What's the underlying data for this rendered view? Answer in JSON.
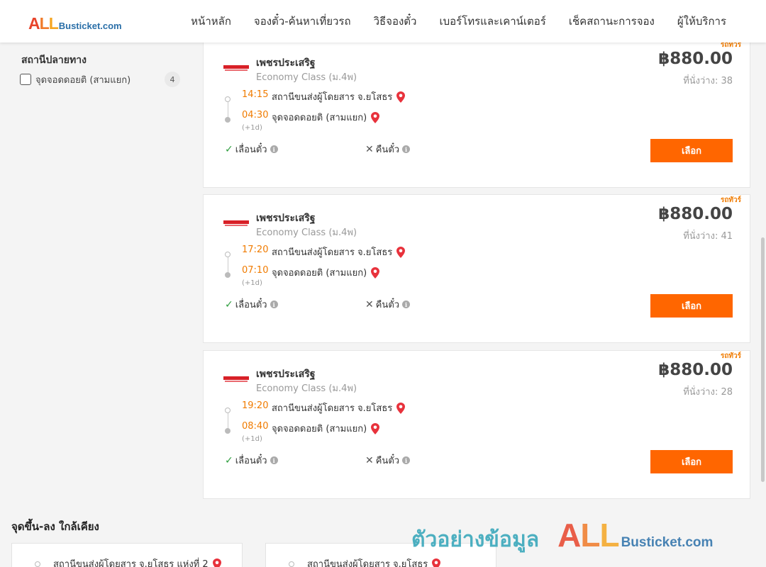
{
  "header": {
    "logo": {
      "part_a": "A",
      "part_l1": "L",
      "part_l2": "L",
      "rest": "Busticket.com"
    },
    "nav": [
      "หน้าหลัก",
      "จองตั๋ว-ค้นหาเที่ยวรถ",
      "วิธีจองตั๋ว",
      "เบอร์โทรและเคาน์เตอร์",
      "เช็คสถานะการจอง",
      "ผู้ให้บริการ"
    ]
  },
  "filter": {
    "title": "สถานีปลายทาง",
    "options": [
      {
        "label": "จุดจอดดอยติ (สามแยก)",
        "count": "4",
        "checked": false
      }
    ]
  },
  "trips": [
    {
      "badge": "รถทัวร์",
      "operator": "เพชรประเสริฐ",
      "bus_class": "Economy Class (ม.4พ)",
      "price": "฿880.00",
      "seats": "ที่นั่งว่าง: 38",
      "dep_time": "14:15",
      "dep_place": "สถานีขนส่งผู้โดยสาร จ.ยโสธร",
      "arr_time": "04:30",
      "arr_place": "จุดจอดดอยติ (สามแยก)",
      "next_day": "(+1d)",
      "change_label": "เลื่อนตั๋ว",
      "refund_label": "คืนตั๋ว",
      "button": "เลือก"
    },
    {
      "badge": "รถทัวร์",
      "operator": "เพชรประเสริฐ",
      "bus_class": "Economy Class (ม.4พ)",
      "price": "฿880.00",
      "seats": "ที่นั่งว่าง: 41",
      "dep_time": "17:20",
      "dep_place": "สถานีขนส่งผู้โดยสาร จ.ยโสธร",
      "arr_time": "07:10",
      "arr_place": "จุดจอดดอยติ (สามแยก)",
      "next_day": "(+1d)",
      "change_label": "เลื่อนตั๋ว",
      "refund_label": "คืนตั๋ว",
      "button": "เลือก"
    },
    {
      "badge": "รถทัวร์",
      "operator": "เพชรประเสริฐ",
      "bus_class": "Economy Class (ม.4พ)",
      "price": "฿880.00",
      "seats": "ที่นั่งว่าง: 28",
      "dep_time": "19:20",
      "dep_place": "สถานีขนส่งผู้โดยสาร จ.ยโสธร",
      "arr_time": "08:40",
      "arr_place": "จุดจอดดอยติ (สามแยก)",
      "next_day": "(+1d)",
      "change_label": "เลื่อนตั๋ว",
      "refund_label": "คืนตั๋ว",
      "button": "เลือก"
    }
  ],
  "nearby": {
    "title": "จุดขึ้น-ลง ใกล้เคียง",
    "items": [
      "สถานีขนส่งผู้โดยสาร จ.ยโสธร แห่งที่ 2",
      "สถานีขนส่งผู้โดยสาร จ.ยโสธร"
    ]
  },
  "watermark": {
    "thai": "ตัวอย่างข้อมูล",
    "part_a": "A",
    "part_l1": "L",
    "part_l2": "L",
    "rest": "Busticket.com"
  },
  "icons": {
    "pin": "map-pin-icon",
    "check": "check-icon",
    "cross": "cross-icon",
    "info": "info-icon",
    "operator_logo": "operator-logo-icon"
  },
  "colors": {
    "accent": "#ff6600",
    "time": "#f07b00",
    "ok": "#2e9e3e",
    "pin": "#e8323c",
    "logo_blue": "#2a6fa8"
  }
}
